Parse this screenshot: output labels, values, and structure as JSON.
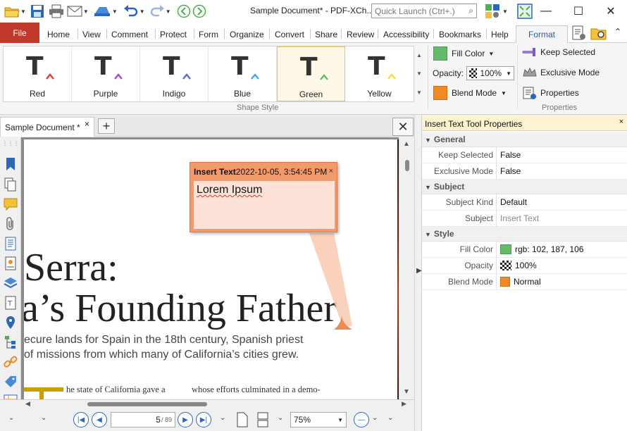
{
  "window": {
    "title": "Sample Document* - PDF-XCh...",
    "quick_launch_placeholder": "Quick Launch (Ctrl+.)"
  },
  "ribbon_tabs": [
    {
      "label": "File"
    },
    {
      "label": "Home"
    },
    {
      "label": "View"
    },
    {
      "label": "Comment"
    },
    {
      "label": "Protect"
    },
    {
      "label": "Form"
    },
    {
      "label": "Organize"
    },
    {
      "label": "Convert"
    },
    {
      "label": "Share"
    },
    {
      "label": "Review"
    },
    {
      "label": "Accessibility"
    },
    {
      "label": "Bookmarks"
    },
    {
      "label": "Help"
    },
    {
      "label": "Format"
    }
  ],
  "shape_style": {
    "group_label": "Shape Style",
    "items": [
      {
        "label": "Red",
        "color": "#e53935"
      },
      {
        "label": "Purple",
        "color": "#9c4dcc"
      },
      {
        "label": "Indigo",
        "color": "#5c6bc0"
      },
      {
        "label": "Blue",
        "color": "#42a5f5"
      },
      {
        "label": "Green",
        "color": "#66bb6a"
      },
      {
        "label": "Yellow",
        "color": "#fdd835"
      }
    ],
    "selected": "Green"
  },
  "format_controls": {
    "fill_color_label": "Fill Color",
    "opacity_label": "Opacity:",
    "opacity_value": "100%",
    "blend_mode_label": "Blend Mode"
  },
  "properties_group": {
    "group_label": "Properties",
    "keep_selected": "Keep Selected",
    "exclusive_mode": "Exclusive Mode",
    "properties": "Properties"
  },
  "document_tab": {
    "label": "Sample Document *"
  },
  "page": {
    "title_line1": "Serra:",
    "title_line2": "a’s Founding Father",
    "subtitle_line1": "ecure lands for Spain in the 18th century, Spanish priest",
    "subtitle_line2": "of missions from which many of California’s cities grew.",
    "body_left": "he state of California gave a",
    "body_right": "whose efforts culminated in a demo-"
  },
  "comment_popup": {
    "type": "Insert Text",
    "timestamp": "2022-10-05, 3:54:45 PM",
    "close": "×",
    "text": "Lorem Ipsum"
  },
  "navigation": {
    "current_page": "5",
    "total_pages": "/ 89",
    "zoom": "75%"
  },
  "properties_panel": {
    "title": "Insert Text Tool Properties",
    "close": "×",
    "sections": {
      "general": "General",
      "subject": "Subject",
      "style": "Style"
    },
    "rows": {
      "keep_selected_key": "Keep Selected",
      "keep_selected_val": "False",
      "exclusive_mode_key": "Exclusive Mode",
      "exclusive_mode_val": "False",
      "subject_kind_key": "Subject Kind",
      "subject_kind_val": "Default",
      "subject_key": "Subject",
      "subject_val": "Insert Text",
      "fill_color_key": "Fill Color",
      "fill_color_val": "rgb: 102, 187, 106",
      "opacity_key": "Opacity",
      "opacity_val": "100%",
      "blend_mode_key": "Blend Mode",
      "blend_mode_val": "Normal"
    }
  },
  "colors": {
    "accent_file_tab": "#c0392b",
    "popup_fill": "#f39a6b",
    "fill_green": "#66bb6a",
    "blend_orange": "#f08a24"
  }
}
